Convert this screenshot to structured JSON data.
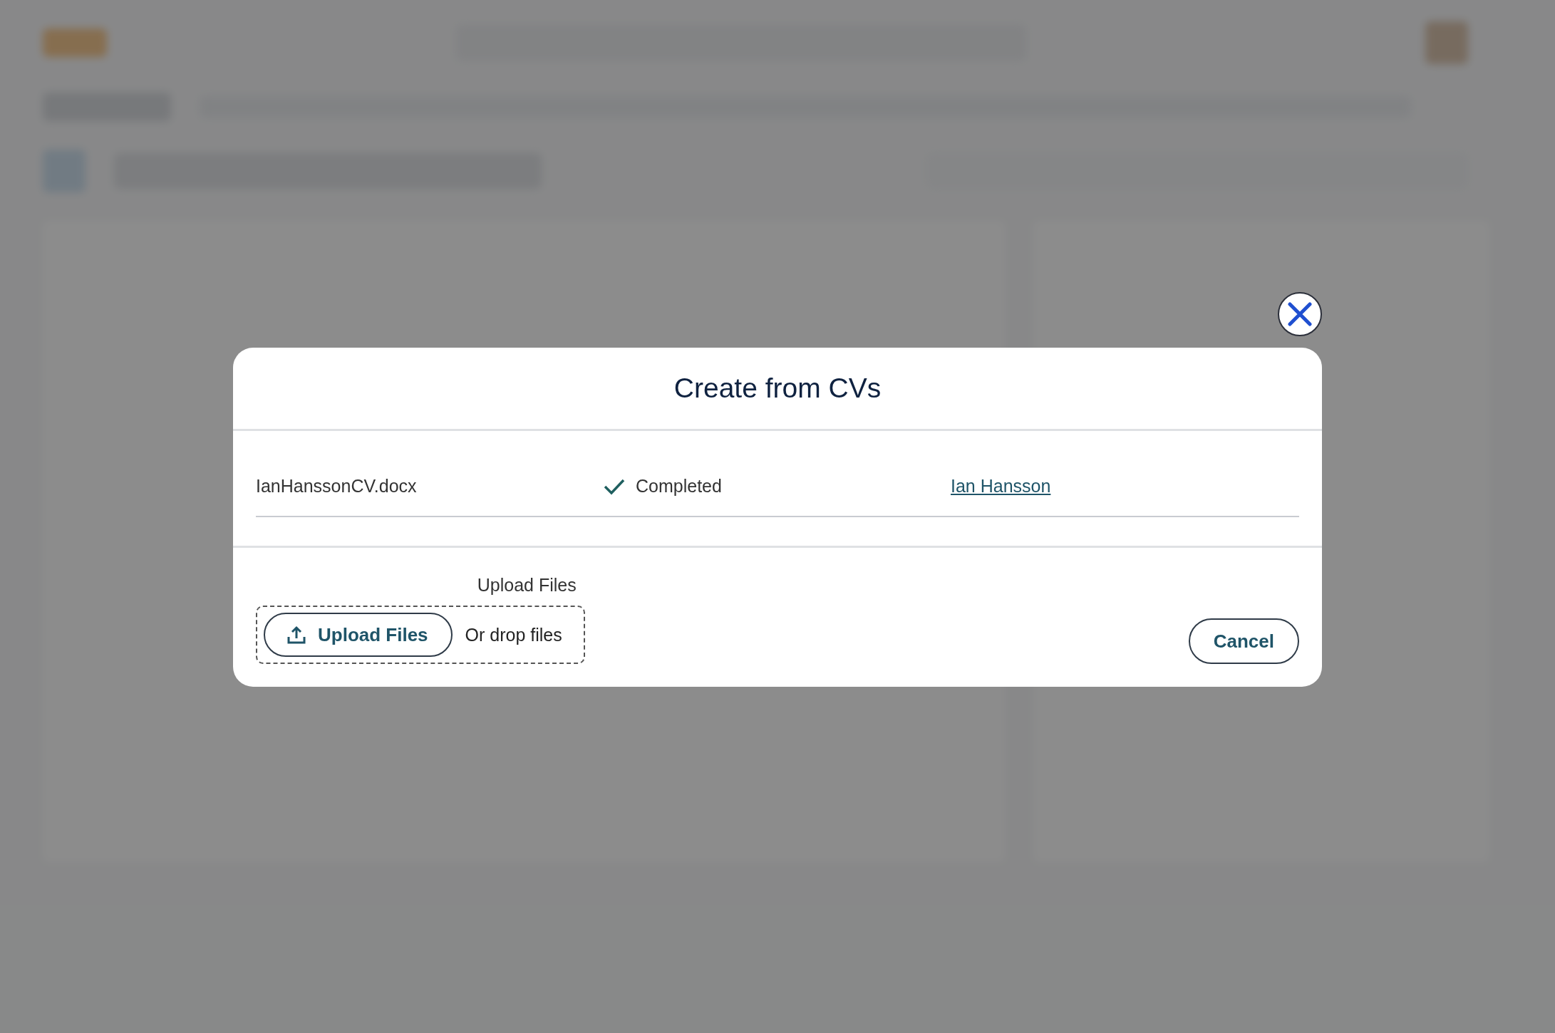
{
  "dialog": {
    "title": "Create from CVs",
    "files": [
      {
        "filename": "IanHanssonCV.docx",
        "status": "Completed",
        "kind": "completed",
        "candidate": "Ian Hansson"
      }
    ],
    "upload": {
      "label": "Upload Files",
      "button": "Upload Files",
      "drop_hint": "Or drop files"
    },
    "buttons": [
      {
        "label": "Cancel"
      }
    ]
  }
}
